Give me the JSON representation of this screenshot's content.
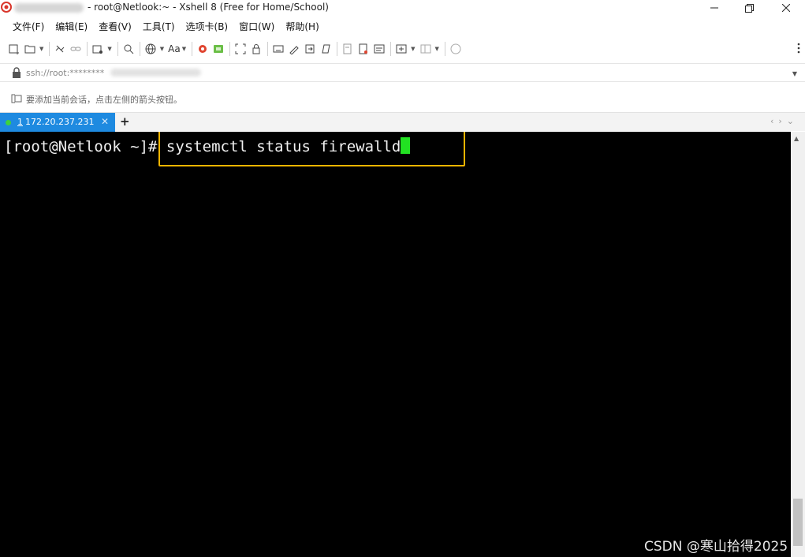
{
  "window": {
    "title": "- root@Netlook:~ - Xshell 8 (Free for Home/School)"
  },
  "menu": [
    "文件(F)",
    "编辑(E)",
    "查看(V)",
    "工具(T)",
    "选项卡(B)",
    "窗口(W)",
    "帮助(H)"
  ],
  "toolbar": {
    "font_label": "Aa"
  },
  "address": {
    "value": "ssh://root:********"
  },
  "hint": {
    "text": "要添加当前会话，点击左侧的箭头按钮。"
  },
  "tabs": [
    {
      "number": "1",
      "label": " 172.20.237.231",
      "status": "connected"
    }
  ],
  "terminal": {
    "prompt": "[root@Netlook ~]",
    "command": "# systemctl status firewalld"
  },
  "watermark": "CSDN @寒山拾得2025",
  "colors": {
    "tab_active": "#1e8ae0",
    "tab_status_dot": "#3ed23e",
    "terminal_bg": "#000000",
    "terminal_fg": "#f0f0f0",
    "cursor": "#22e222",
    "highlight_border": "#f5b400"
  }
}
